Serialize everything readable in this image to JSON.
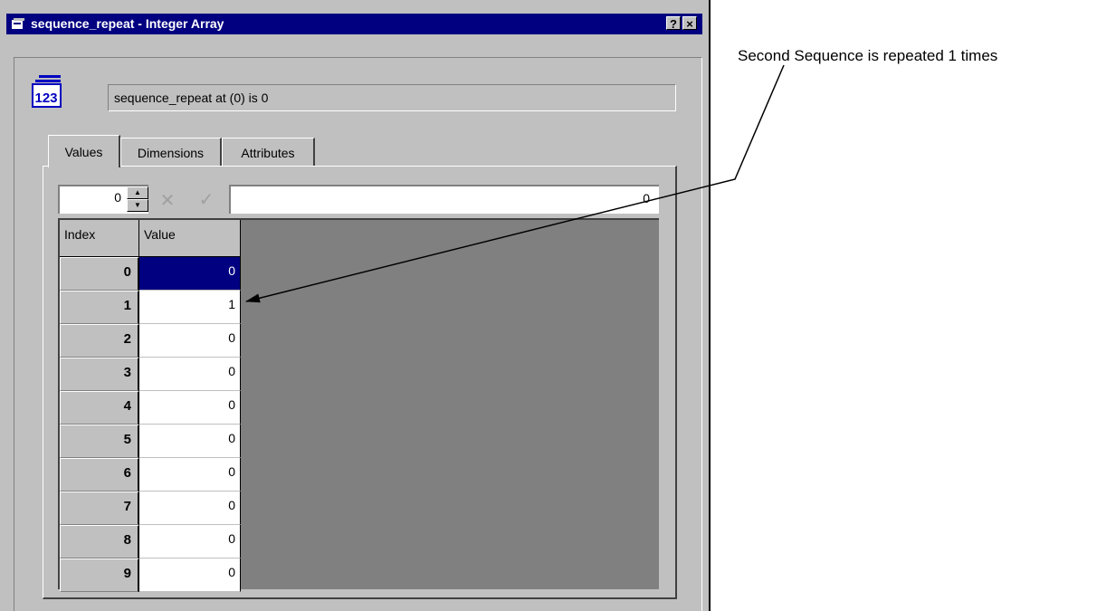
{
  "window": {
    "title": "sequence_repeat - Integer Array",
    "help_label": "?",
    "close_label": "×"
  },
  "icon": {
    "name": "integer-array-icon",
    "text": "123"
  },
  "status_text": "sequence_repeat at (0) is 0",
  "tabs": [
    {
      "label": "Values",
      "active": true
    },
    {
      "label": "Dimensions",
      "active": false
    },
    {
      "label": "Attributes",
      "active": false
    }
  ],
  "editor": {
    "spin_value": "0",
    "edit_value": "0",
    "cancel_icon": "cancel-icon",
    "accept_icon": "check-icon"
  },
  "grid": {
    "headers": [
      "Index",
      "Value"
    ],
    "rows": [
      {
        "index": "0",
        "value": "0"
      },
      {
        "index": "1",
        "value": "1"
      },
      {
        "index": "2",
        "value": "0"
      },
      {
        "index": "3",
        "value": "0"
      },
      {
        "index": "4",
        "value": "0"
      },
      {
        "index": "5",
        "value": "0"
      },
      {
        "index": "6",
        "value": "0"
      },
      {
        "index": "7",
        "value": "0"
      },
      {
        "index": "8",
        "value": "0"
      },
      {
        "index": "9",
        "value": "0"
      }
    ]
  },
  "annotation": {
    "text": "Second Sequence is repeated 1 times"
  },
  "colors": {
    "titlebar": "#000080",
    "face": "#c0c0c0",
    "selection": "#000080",
    "grid_bg": "#808080"
  }
}
